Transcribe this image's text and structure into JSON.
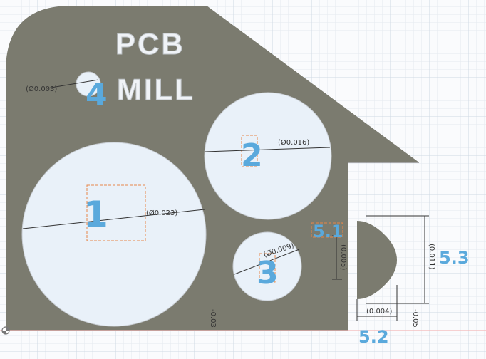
{
  "engraving": {
    "line1": "PCB",
    "line2": "MILL"
  },
  "features": {
    "f1": {
      "label": "1",
      "dim": "(Ø0.023)"
    },
    "f2": {
      "label": "2",
      "dim": "(Ø0.016)"
    },
    "f3": {
      "label": "3",
      "dim": "(Ø0.009)"
    },
    "f4": {
      "label": "4",
      "dim": "(Ø0.003)"
    },
    "f51": {
      "label": "5.1",
      "dim": "(0.005)"
    },
    "f52": {
      "label": "5.2",
      "dim": "(0.004)"
    },
    "f53": {
      "label": "5.3",
      "dim": "(0.011)"
    }
  },
  "axis_labels": {
    "left": "-0.03",
    "right": "-0.05"
  },
  "colors": {
    "part": "#7b7b6f",
    "hole": "#e9f1f9",
    "label": "#5aa9dc",
    "sketch": "#e7874a",
    "grid_minor": "#e4e9f0",
    "grid_major": "#cfd8e3",
    "ground_line": "#f3b7b7"
  },
  "icons": {
    "origin": "origin-marker-icon"
  }
}
